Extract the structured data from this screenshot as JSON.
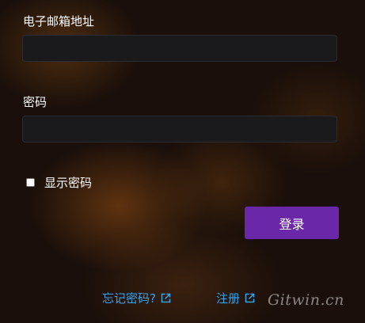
{
  "email": {
    "label": "电子邮箱地址",
    "value": "",
    "placeholder": ""
  },
  "password": {
    "label": "密码",
    "value": "",
    "placeholder": ""
  },
  "show_password": {
    "label": "显示密码",
    "checked": false
  },
  "login_button": {
    "label": "登录"
  },
  "links": {
    "forgot_password": "忘记密码?",
    "register": "注册"
  },
  "watermark": "Gitwin.cn",
  "colors": {
    "accent": "#6a27a8",
    "link": "#35a3ef"
  }
}
